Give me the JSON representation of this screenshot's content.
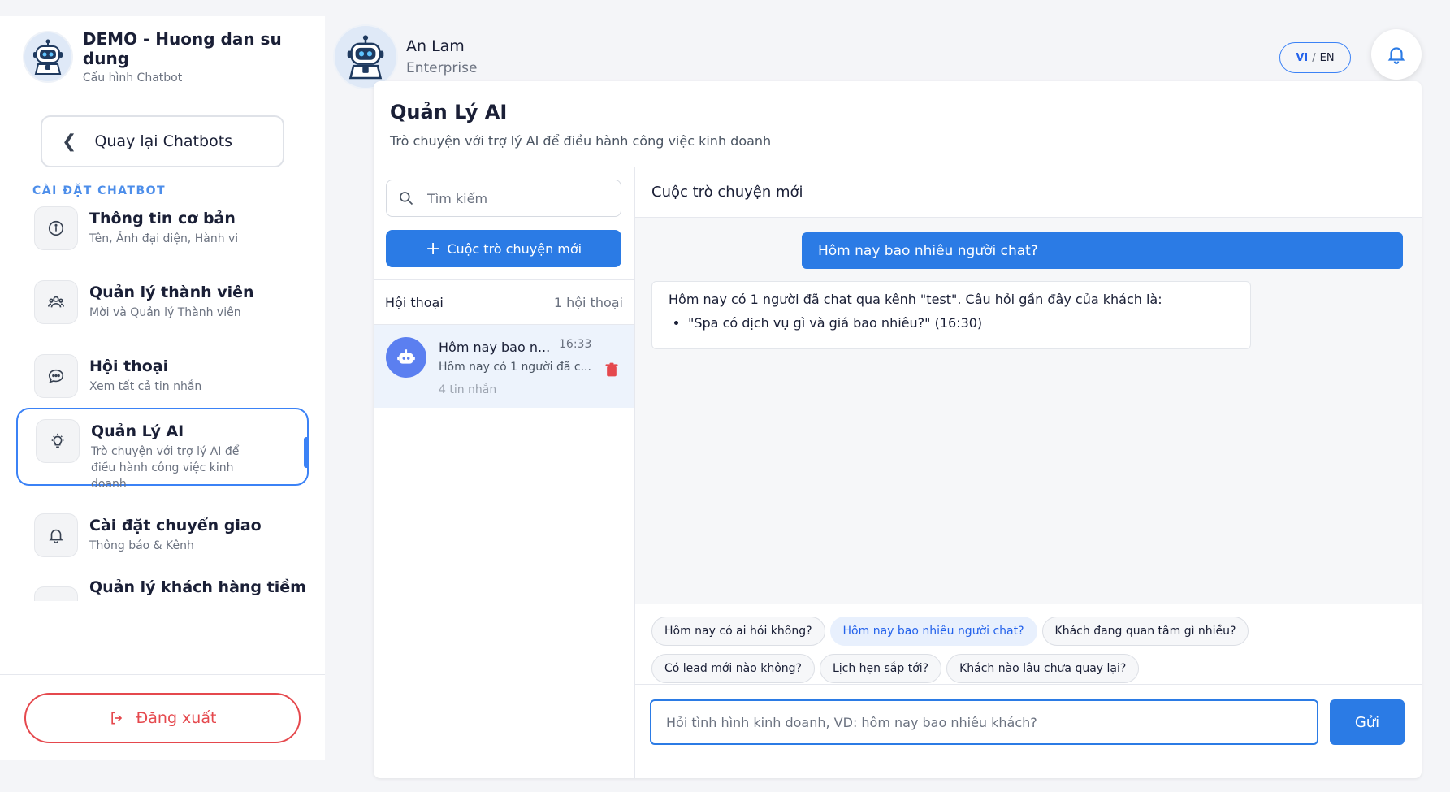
{
  "sidebar": {
    "bot_title": "DEMO - Huong dan su dung",
    "bot_subtitle": "Cấu hình Chatbot",
    "back_label": "Quay lại Chatbots",
    "section_label": "CÀI ĐẶT CHATBOT",
    "items": [
      {
        "title": "Thông tin cơ bản",
        "desc": "Tên, Ảnh đại diện, Hành vi",
        "icon": "info-icon"
      },
      {
        "title": "Quản lý thành viên",
        "desc": "Mời và Quản lý Thành viên",
        "icon": "users-icon"
      },
      {
        "title": "Hội thoại",
        "desc": "Xem tất cả tin nhắn",
        "icon": "chat-bubble-icon"
      },
      {
        "title": "Quản Lý AI",
        "desc": "Trò chuyện với trợ lý AI để điều hành công việc kinh doanh",
        "icon": "lightbulb-icon",
        "active": true
      },
      {
        "title": "Cài đặt chuyển giao",
        "desc": "Thông báo & Kênh",
        "icon": "bell-icon"
      },
      {
        "title": "Quản lý khách hàng tiềm",
        "desc": "",
        "icon": "contacts-icon"
      }
    ],
    "logout_label": "Đăng xuất"
  },
  "header": {
    "user_name": "An Lam",
    "user_plan": "Enterprise",
    "lang_vi": "VI",
    "lang_sep": "/",
    "lang_en": "EN"
  },
  "main": {
    "title": "Quản Lý AI",
    "subtitle": "Trò chuyện với trợ lý AI để điều hành công việc kinh doanh"
  },
  "conversations": {
    "search_placeholder": "Tìm kiếm",
    "new_button": "Cuộc trò chuyện mới",
    "list_label": "Hội thoại",
    "list_count": "1 hội thoại",
    "items": [
      {
        "title": "Hôm nay bao n...",
        "time": "16:33",
        "preview": "Hôm nay có 1 người đã c...",
        "count": "4 tin nhắn"
      }
    ]
  },
  "chat": {
    "header": "Cuộc trò chuyện mới",
    "user_message": "Hôm nay bao nhiêu người chat?",
    "bot_message": "Hôm nay có 1 người đã chat qua kênh \"test\". Câu hỏi gần đây của khách là:",
    "bot_bullet": "\"Spa có dịch vụ gì và giá bao nhiêu?\" (16:30)",
    "suggestions": [
      "Hôm nay có ai hỏi không?",
      "Hôm nay bao nhiêu người chat?",
      "Khách đang quan tâm gì nhiều?",
      "Có lead mới nào không?",
      "Lịch hẹn sắp tới?",
      "Khách nào lâu chưa quay lại?"
    ],
    "input_placeholder": "Hỏi tình hình kinh doanh, VD: hôm nay bao nhiêu khách?",
    "send_label": "Gửi"
  },
  "colors": {
    "accent": "#2b7be5",
    "danger": "#e5484d",
    "section_label": "#4d8eea"
  }
}
